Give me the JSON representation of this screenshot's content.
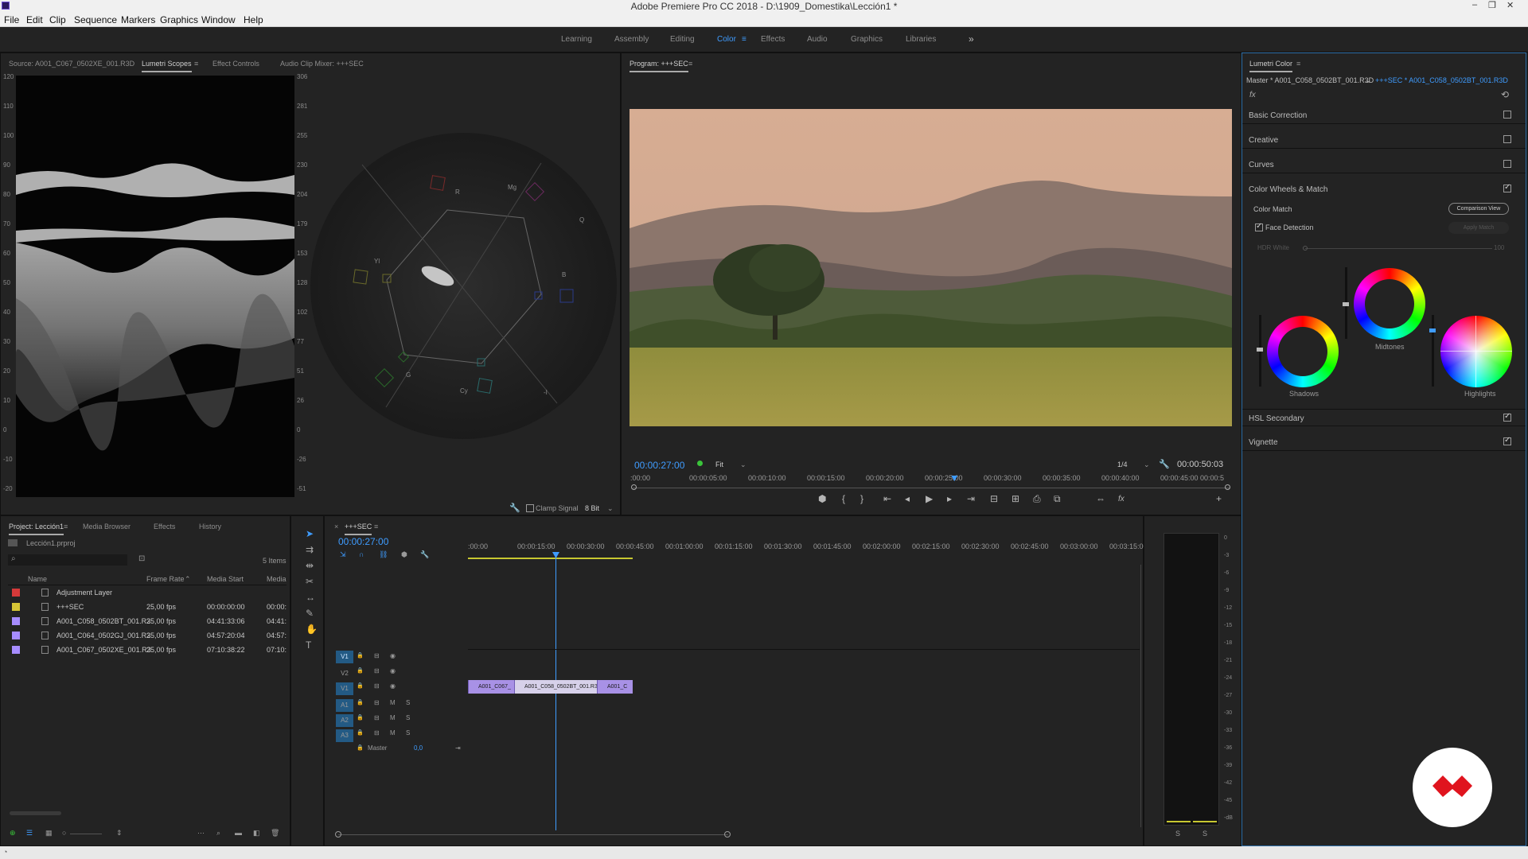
{
  "window": {
    "title": "Adobe Premiere Pro CC 2018 - D:\\1909_Domestika\\Lección1 *"
  },
  "menu": [
    "File",
    "Edit",
    "Clip",
    "Sequence",
    "Markers",
    "Graphics",
    "Window",
    "Help"
  ],
  "workspaces": [
    "Learning",
    "Assembly",
    "Editing",
    "Color",
    "Effects",
    "Audio",
    "Graphics",
    "Libraries"
  ],
  "workspace_active": "Color",
  "source_panel": {
    "tabs": [
      "Source: A001_C067_0502XE_001.R3D",
      "Lumetri Scopes",
      "Effect Controls",
      "Audio Clip Mixer: +++SEC"
    ],
    "active": "Lumetri Scopes"
  },
  "scopes": {
    "left_scale": [
      "120",
      "110",
      "100",
      "90",
      "80",
      "70",
      "60",
      "50",
      "40",
      "30",
      "20",
      "10",
      "0",
      "-10",
      "-20"
    ],
    "right_scale": [
      "306",
      "281",
      "255",
      "230",
      "204",
      "179",
      "153",
      "128",
      "102",
      "77",
      "51",
      "26",
      "0",
      "-26",
      "-51"
    ],
    "vector_labels": [
      "R",
      "Mg",
      "B",
      "Cy",
      "G",
      "Yl",
      "Q",
      "-I"
    ],
    "clamp_label": "Clamp Signal",
    "bit_depth": "8 Bit"
  },
  "program": {
    "title": "Program: +++SEC",
    "timecode": "00:00:27:00",
    "fit": "Fit",
    "resolution": "1/4",
    "duration": "00:00:50:03",
    "ruler": [
      ":00:00",
      "00:00:05:00",
      "00:00:10:00",
      "00:00:15:00",
      "00:00:20:00",
      "00:00:25:00",
      "00:00:30:00",
      "00:00:35:00",
      "00:00:40:00",
      "00:00:45:00",
      "00:00:5"
    ],
    "playhead_fraction": 0.539,
    "transport": [
      "⬢",
      "{",
      "}",
      "⇤",
      "◂",
      "▶",
      "▸",
      "⇥",
      "⊟",
      "⊞",
      "⎙",
      "⧉",
      "⇔",
      "fx",
      "+"
    ]
  },
  "lumetri": {
    "title": "Lumetri Color",
    "master": "Master * A001_C058_0502BT_001.R3D",
    "clip": "+++SEC * A001_C058_0502BT_001.R3D",
    "fx": "fx",
    "sections": [
      {
        "label": "Basic Correction",
        "checked": false
      },
      {
        "label": "Creative",
        "checked": false
      },
      {
        "label": "Curves",
        "checked": false
      },
      {
        "label": "Color Wheels & Match",
        "checked": true
      }
    ],
    "color_match": "Color Match",
    "comparison_view": "Comparison View",
    "face_detection": "Face Detection",
    "apply_match": "Apply Match",
    "hdr_white": "HDR White",
    "hdr_value": "100",
    "wheels": [
      "Shadows",
      "Midtones",
      "Highlights"
    ],
    "sections_after": [
      {
        "label": "HSL Secondary",
        "checked": true
      },
      {
        "label": "Vignette",
        "checked": true
      }
    ]
  },
  "project": {
    "tabs": [
      "Project: Lección1",
      "Media Browser",
      "Effects",
      "History"
    ],
    "active": "Project: Lección1",
    "file": "Lección1.prproj",
    "items_count": "5 Items",
    "columns": [
      "Name",
      "Frame Rate",
      "Media Start",
      "Media"
    ],
    "rows": [
      {
        "color": "#d63a3a",
        "name": "Adjustment Layer",
        "fps": "",
        "start": "",
        "media": ""
      },
      {
        "color": "#d6c636",
        "name": "+++SEC",
        "fps": "25,00 fps",
        "start": "00:00:00:00",
        "media": "00:00:"
      },
      {
        "color": "#a68cff",
        "name": "A001_C058_0502BT_001.R3",
        "fps": "25,00 fps",
        "start": "04:41:33:06",
        "media": "04:41:"
      },
      {
        "color": "#a68cff",
        "name": "A001_C064_0502GJ_001.R3",
        "fps": "25,00 fps",
        "start": "04:57:20:04",
        "media": "04:57:"
      },
      {
        "color": "#a68cff",
        "name": "A001_C067_0502XE_001.R3",
        "fps": "25,00 fps",
        "start": "07:10:38:22",
        "media": "07:10:"
      }
    ]
  },
  "timeline": {
    "tab": "+++SEC",
    "timecode": "00:00:27:00",
    "ruler": [
      ":00:00",
      "00:00:15:00",
      "00:00:30:00",
      "00:00:45:00",
      "00:01:00:00",
      "00:01:15:00",
      "00:01:30:00",
      "00:01:45:00",
      "00:02:00:00",
      "00:02:15:00",
      "00:02:30:00",
      "00:02:45:00",
      "00:03:00:00",
      "00:03:15:00"
    ],
    "video_tracks": [
      "V3",
      "V2",
      "V1"
    ],
    "audio_tracks": [
      "A1",
      "A2",
      "A3"
    ],
    "master": "Master",
    "master_value": "0,0",
    "clips": [
      "A001_C067_",
      "A001_C058_0502BT_001.R3",
      "A001_C"
    ]
  },
  "audio_meter": {
    "scale": [
      "0",
      "-3",
      "-6",
      "-9",
      "-12",
      "-15",
      "-18",
      "-21",
      "-24",
      "-27",
      "-30",
      "-33",
      "-36",
      "-39",
      "-42",
      "-45",
      "-dB"
    ],
    "solo": [
      "S",
      "S"
    ]
  },
  "colors": {
    "accent": "#3f9cff",
    "clip": "#a891e6",
    "bg": "#232323"
  }
}
